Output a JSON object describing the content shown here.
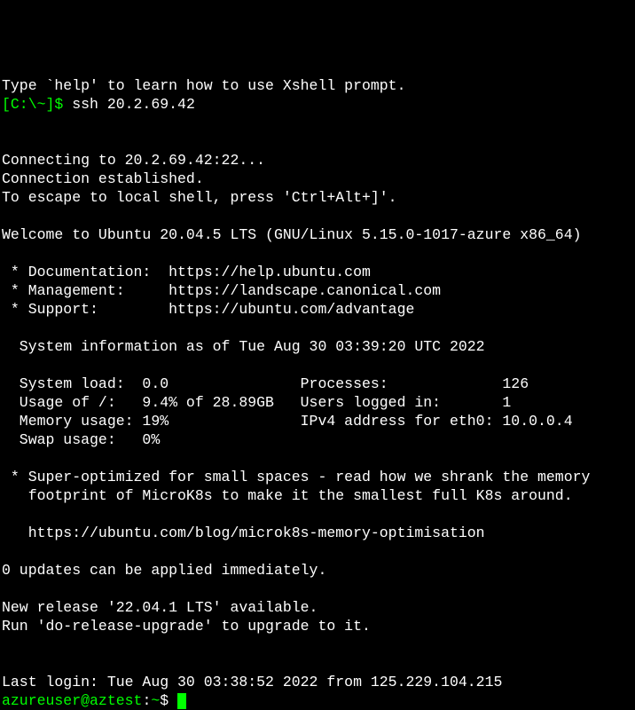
{
  "hint": "Type `help' to learn how to use Xshell prompt.",
  "prompt1_prefix": "[C:\\~]$ ",
  "prompt1_cmd": "ssh 20.2.69.42",
  "connecting": "Connecting to 20.2.69.42:22...",
  "established": "Connection established.",
  "escape": "To escape to local shell, press 'Ctrl+Alt+]'.",
  "welcome": "Welcome to Ubuntu 20.04.5 LTS (GNU/Linux 5.15.0-1017-azure x86_64)",
  "links": {
    "doc": " * Documentation:  https://help.ubuntu.com",
    "mgmt": " * Management:     https://landscape.canonical.com",
    "support": " * Support:        https://ubuntu.com/advantage"
  },
  "sysinfo_header": "  System information as of Tue Aug 30 03:39:20 UTC 2022",
  "stats": {
    "l1": "  System load:  0.0               Processes:             126",
    "l2": "  Usage of /:   9.4% of 28.89GB   Users logged in:       1",
    "l3": "  Memory usage: 19%               IPv4 address for eth0: 10.0.0.4",
    "l4": "  Swap usage:   0%"
  },
  "microk8s": {
    "l1": " * Super-optimized for small spaces - read how we shrank the memory",
    "l2": "   footprint of MicroK8s to make it the smallest full K8s around.",
    "l3": "   https://ubuntu.com/blog/microk8s-memory-optimisation"
  },
  "updates": "0 updates can be applied immediately.",
  "release": {
    "l1": "New release '22.04.1 LTS' available.",
    "l2": "Run 'do-release-upgrade' to upgrade to it."
  },
  "lastlogin": "Last login: Tue Aug 30 03:38:52 2022 from 125.229.104.215",
  "prompt2_userhost": "azureuser@aztest",
  "prompt2_colon": ":",
  "prompt2_path": "~",
  "prompt2_dollar": "$ "
}
